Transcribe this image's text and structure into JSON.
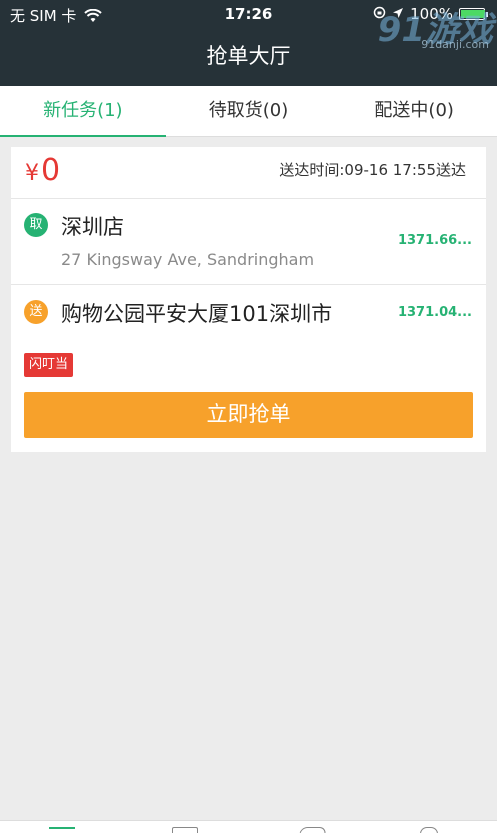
{
  "status_bar": {
    "carrier": "无 SIM 卡",
    "time": "17:26",
    "battery": "100%",
    "watermark_big": "91游戏",
    "watermark_small": "91danji.com"
  },
  "header": {
    "title": "抢单大厅"
  },
  "tabs": [
    {
      "label": "新任务(1)",
      "active": true
    },
    {
      "label": "待取货(0)",
      "active": false
    },
    {
      "label": "配送中(0)",
      "active": false
    }
  ],
  "order": {
    "currency": "¥",
    "amount": "0",
    "eta": "送达时间:09-16 17:55送达",
    "pickup": {
      "badge": "取",
      "name": "深圳店",
      "address": "27 Kingsway Ave, Sandringham",
      "distance": "1371.66..."
    },
    "dropoff": {
      "badge": "送",
      "name": "购物公园平安大厦101深圳市",
      "distance": "1371.04..."
    },
    "tag": "闪叮当",
    "action_label": "立即抢单"
  },
  "colors": {
    "header_bg": "#263238",
    "accent_green": "#26b273",
    "accent_orange": "#f7a12b",
    "price_red": "#e53935"
  }
}
